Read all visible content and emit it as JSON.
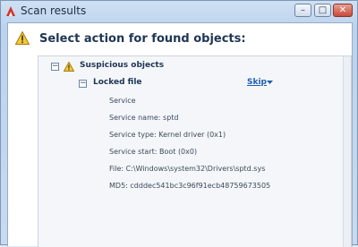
{
  "window": {
    "title": "Scan results",
    "controls": {
      "minimize": "–",
      "maximize": "□",
      "close": "✕"
    }
  },
  "header": {
    "icon": "warning-icon",
    "title": "Select action for found objects:"
  },
  "groups": [
    {
      "expander": "−",
      "icon": "warning-icon",
      "title": "Suspicious objects",
      "items": [
        {
          "expander": "−",
          "title": "Locked file",
          "action": "Skip",
          "details": [
            "Service",
            "Service name: sptd",
            "Service type: Kernel driver (0x1)",
            "Service start: Boot (0x0)",
            "File: C:\\Windows\\system32\\Drivers\\sptd.sys",
            "MD5: cdddec541bc3c96f91ecb48759673505"
          ]
        }
      ]
    }
  ],
  "colors": {
    "accent_link": "#1f5fb0",
    "warning_fill": "#f6c834",
    "close_button": "#c7493a"
  }
}
